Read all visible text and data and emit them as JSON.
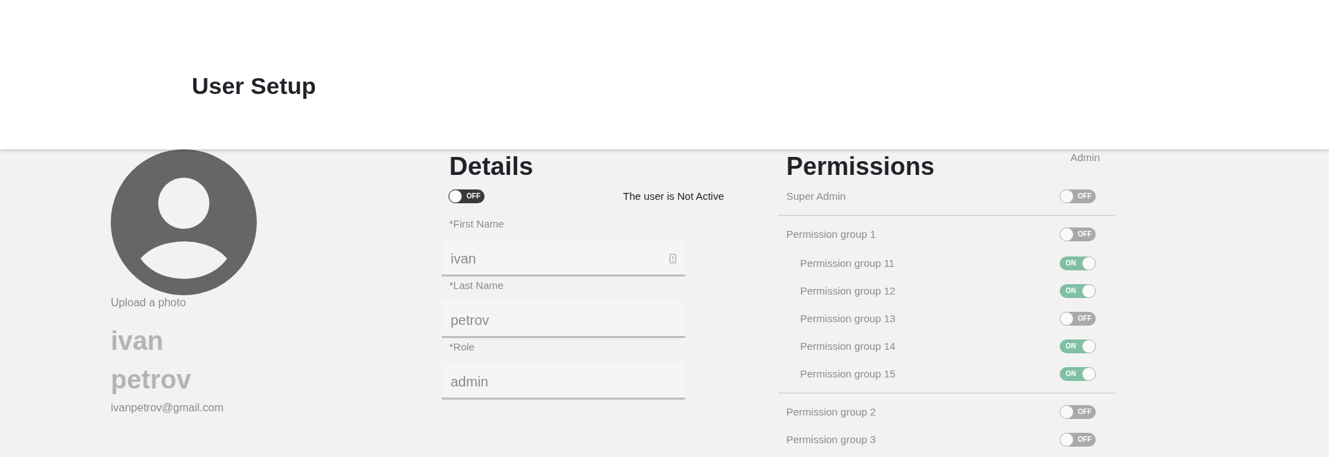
{
  "header": {
    "title": "User Setup"
  },
  "profile": {
    "upload_label": "Upload a photo",
    "first_name": "ivan",
    "last_name": "petrov",
    "email": "ivanpetrov@gmail.com"
  },
  "details": {
    "title": "Details",
    "active_toggle": {
      "on": false,
      "disabled": false,
      "text": "OFF"
    },
    "status_text": "The user is Not Active",
    "fields": [
      {
        "label": "*First Name",
        "value": "ivan",
        "kind": "with_icon"
      },
      {
        "label": "*Last Name",
        "value": "petrov",
        "kind": "plain"
      },
      {
        "label": "*Role",
        "value": "admin",
        "kind": "plain"
      }
    ]
  },
  "permissions": {
    "title": "Permissions",
    "column_label": "Admin",
    "sections": [
      {
        "items": [
          {
            "label": "Super Admin",
            "toggle": {
              "on": false,
              "disabled": true,
              "text": "OFF"
            }
          }
        ]
      },
      {
        "items": [
          {
            "label": "Permission group 1",
            "toggle": {
              "on": false,
              "disabled": true,
              "text": "OFF"
            },
            "children": [
              {
                "label": "Permission group 11",
                "toggle": {
                  "on": true,
                  "disabled": true,
                  "text": "ON"
                }
              },
              {
                "label": "Permission group 12",
                "toggle": {
                  "on": true,
                  "disabled": true,
                  "text": "ON"
                }
              },
              {
                "label": "Permission group 13",
                "toggle": {
                  "on": false,
                  "disabled": true,
                  "text": "OFF"
                }
              },
              {
                "label": "Permission group 14",
                "toggle": {
                  "on": true,
                  "disabled": true,
                  "text": "ON"
                }
              },
              {
                "label": "Permission group 15",
                "toggle": {
                  "on": true,
                  "disabled": true,
                  "text": "ON"
                }
              }
            ]
          }
        ]
      },
      {
        "items": [
          {
            "label": "Permission group 2",
            "toggle": {
              "on": false,
              "disabled": true,
              "text": "OFF"
            }
          },
          {
            "label": "Permission group 3",
            "toggle": {
              "on": false,
              "disabled": true,
              "text": "OFF"
            }
          }
        ]
      }
    ]
  }
}
